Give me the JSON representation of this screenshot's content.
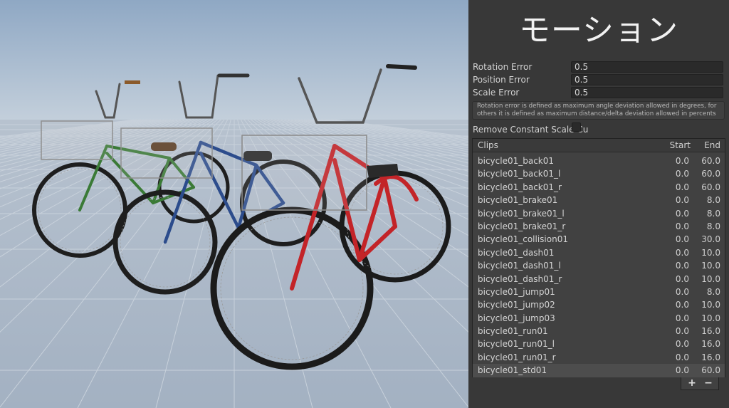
{
  "panel": {
    "title": "モーション",
    "fields": [
      {
        "label": "Rotation Error",
        "value": "0.5"
      },
      {
        "label": "Position Error",
        "value": "0.5"
      },
      {
        "label": "Scale Error",
        "value": "0.5"
      }
    ],
    "help_text": "Rotation error is defined as maximum angle deviation allowed in degrees, for others it is defined as maximum distance/delta deviation allowed in percents",
    "toggle": {
      "label": "Remove Constant Scale Cu",
      "checked": false
    }
  },
  "clips": {
    "headers": {
      "name": "Clips",
      "start": "Start",
      "end": "End"
    },
    "rows": [
      {
        "name": "bicycle01_back01",
        "start": "0.0",
        "end": "60.0"
      },
      {
        "name": "bicycle01_back01_l",
        "start": "0.0",
        "end": "60.0"
      },
      {
        "name": "bicycle01_back01_r",
        "start": "0.0",
        "end": "60.0"
      },
      {
        "name": "bicycle01_brake01",
        "start": "0.0",
        "end": "8.0"
      },
      {
        "name": "bicycle01_brake01_l",
        "start": "0.0",
        "end": "8.0"
      },
      {
        "name": "bicycle01_brake01_r",
        "start": "0.0",
        "end": "8.0"
      },
      {
        "name": "bicycle01_collision01",
        "start": "0.0",
        "end": "30.0"
      },
      {
        "name": "bicycle01_dash01",
        "start": "0.0",
        "end": "10.0"
      },
      {
        "name": "bicycle01_dash01_l",
        "start": "0.0",
        "end": "10.0"
      },
      {
        "name": "bicycle01_dash01_r",
        "start": "0.0",
        "end": "10.0"
      },
      {
        "name": "bicycle01_jump01",
        "start": "0.0",
        "end": "8.0"
      },
      {
        "name": "bicycle01_jump02",
        "start": "0.0",
        "end": "10.0"
      },
      {
        "name": "bicycle01_jump03",
        "start": "0.0",
        "end": "10.0"
      },
      {
        "name": "bicycle01_run01",
        "start": "0.0",
        "end": "16.0"
      },
      {
        "name": "bicycle01_run01_l",
        "start": "0.0",
        "end": "16.0"
      },
      {
        "name": "bicycle01_run01_r",
        "start": "0.0",
        "end": "16.0"
      },
      {
        "name": "bicycle01_std01",
        "start": "0.0",
        "end": "60.0"
      }
    ],
    "selected_index": 16,
    "add_label": "+",
    "remove_label": "−"
  },
  "viewport": {
    "sky_top": "#8fa8c4",
    "sky_horizon": "#c3cfdb",
    "floor_color": "#a9b6c6",
    "bicycles": [
      {
        "name": "green",
        "frame_color": "#2e6e2c"
      },
      {
        "name": "blue",
        "frame_color": "#27457f"
      },
      {
        "name": "red",
        "frame_color": "#c32428"
      }
    ]
  }
}
